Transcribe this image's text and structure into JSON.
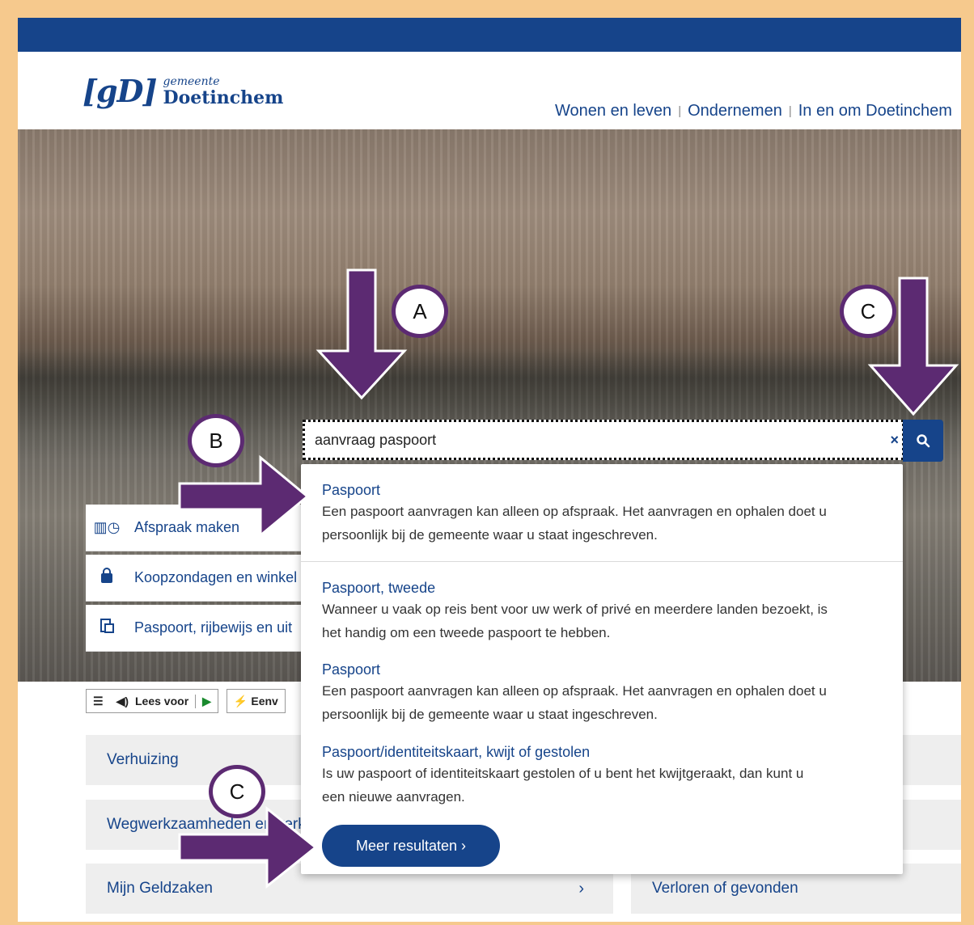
{
  "header": {
    "logo_mark": "[gD]",
    "logo_line1": "gemeente",
    "logo_line2": "Doetinchem",
    "nav": [
      "Wonen en leven",
      "Ondernemen",
      "In en om Doetinchem"
    ],
    "nav_sep": "|"
  },
  "search": {
    "value": "aanvraag paspoort",
    "clear_icon": "×",
    "button_icon": "search-icon"
  },
  "quick_links": [
    {
      "icon": "calendar-clock-icon",
      "label": "Afspraak maken"
    },
    {
      "icon": "shopping-bag-icon",
      "label": "Koopzondagen en winkel"
    },
    {
      "icon": "id-documents-icon",
      "label": "Paspoort, rijbewijs en uit"
    }
  ],
  "readbar": {
    "lees_voor": "Lees voor",
    "eenvoudig": "Eenv"
  },
  "tiles": [
    {
      "label": "Verhuizing"
    },
    {
      "label": "Wegwerkzaamheden en verkeer"
    },
    {
      "label": "Mijn Geldzaken",
      "chevron": "›"
    },
    {
      "label": "Verloren of gevonden"
    }
  ],
  "results": [
    {
      "title": "Paspoort",
      "desc1": "Een paspoort aanvragen kan alleen op afspraak. Het aanvragen en ophalen doet u",
      "desc2": "persoonlijk bij de gemeente waar u staat ingeschreven."
    },
    {
      "title": "Paspoort, tweede",
      "desc1": "Wanneer u vaak op reis bent voor uw werk of privé en meerdere landen bezoekt, is",
      "desc2": "het handig om een tweede paspoort te hebben."
    },
    {
      "title": "Paspoort",
      "desc1": "Een paspoort aanvragen kan alleen op afspraak. Het aanvragen en ophalen doet u",
      "desc2": "persoonlijk bij de gemeente waar u staat ingeschreven."
    },
    {
      "title": "Paspoort/identiteitskaart, kwijt of gestolen",
      "desc1": "Is uw paspoort of identiteitskaart gestolen of u bent het kwijtgeraakt, dan kunt u",
      "desc2": "een nieuwe aanvragen."
    }
  ],
  "more_button": "Meer resultaten ›",
  "annotations": {
    "a": "A",
    "b": "B",
    "c1": "C",
    "c2": "C"
  },
  "colors": {
    "brand": "#16448a",
    "annotation": "#5c2a72",
    "frame": "#f6c98d"
  }
}
